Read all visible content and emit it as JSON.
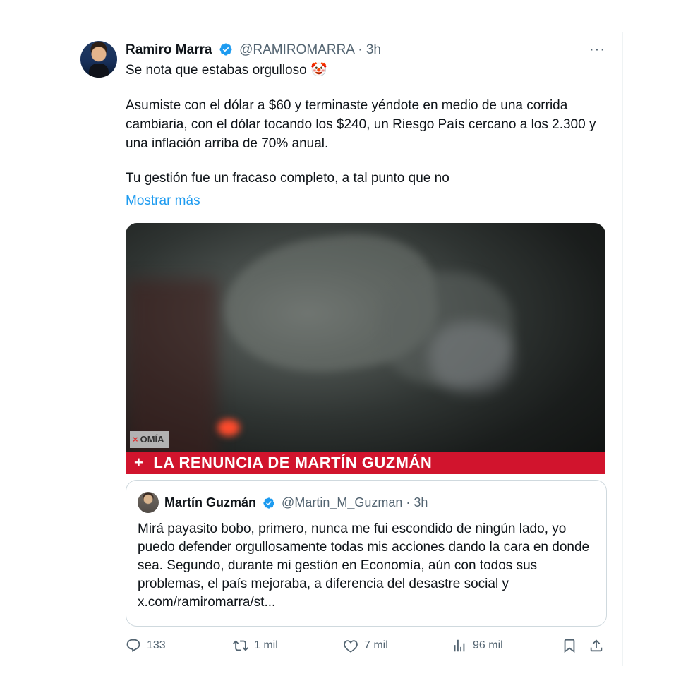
{
  "tweet": {
    "author_name": "Ramiro Marra",
    "handle": "@RAMIROMARRA",
    "time": "3h",
    "line1": "Se nota que estabas orgulloso 🤡",
    "line2": "Asumiste con el dólar a $60 y terminaste yéndote en medio de una corrida cambiaria, con el dólar tocando los $240, un Riesgo País cercano a los 2.300 y una inflación arriba de 70% anual.",
    "line3": "Tu gestión fue un fracaso completo, a tal punto que no",
    "show_more": "Mostrar más",
    "more_icon": "···"
  },
  "media": {
    "section_tag": "OMÍA",
    "section_x": "×",
    "banner_plus": "+",
    "banner_text": "LA RENUNCIA DE MARTÍN GUZMÁN"
  },
  "quote": {
    "author_name": "Martín Guzmán",
    "handle": "@Martin_M_Guzman",
    "time": "3h",
    "text": "Mirá payasito bobo, primero, nunca me fui escondido de ningún lado, yo puedo defender orgullosamente todas mis acciones dando la cara en donde sea. Segundo, durante mi gestión en Economía, aún con todos sus problemas, el país mejoraba, a diferencia del desastre social y x.com/ramiromarra/st..."
  },
  "actions": {
    "reply_count": "133",
    "retweet_count": "1 mil",
    "like_count": "7 mil",
    "views_count": "96 mil"
  },
  "icons": {
    "reply": "reply-icon",
    "retweet": "retweet-icon",
    "like": "heart-icon",
    "views": "views-icon",
    "bookmark": "bookmark-icon",
    "share": "share-icon",
    "verified": "verified-badge-icon"
  },
  "colors": {
    "accent": "#1d9bf0",
    "banner_red": "#d1142d",
    "text": "#0f1419",
    "muted": "#536471"
  }
}
